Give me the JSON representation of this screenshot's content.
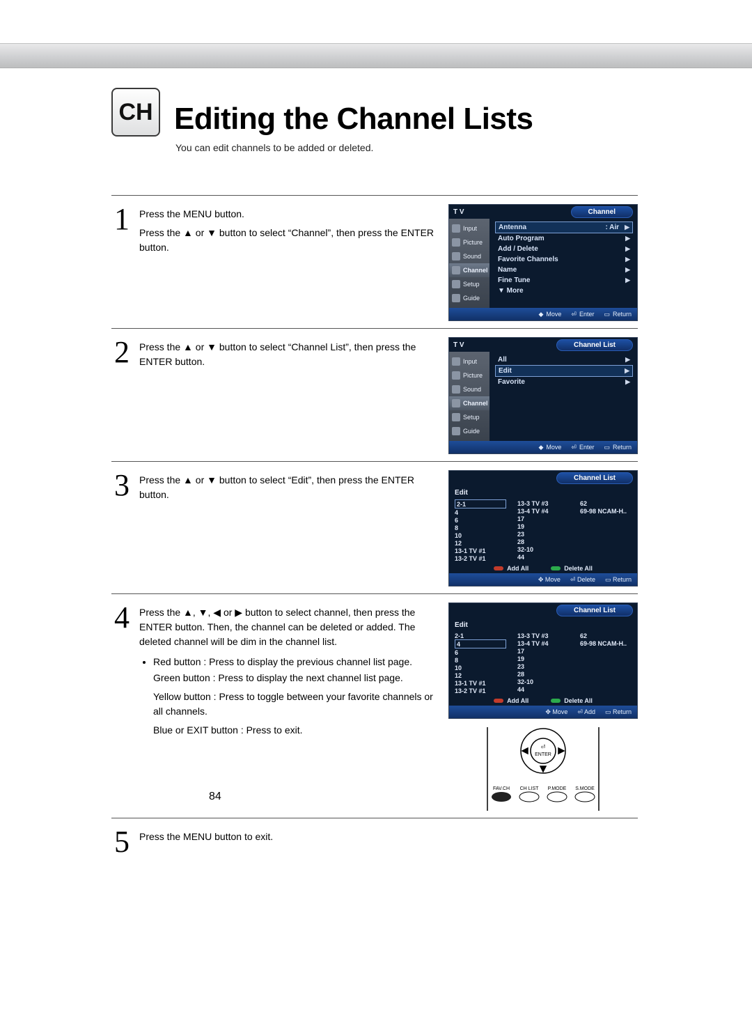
{
  "header": {
    "icon_label": "CH",
    "title": "Editing the Channel Lists",
    "subtitle": "You can edit channels to be added or deleted."
  },
  "page_number": "84",
  "steps": {
    "s1": {
      "num": "1",
      "p1": "Press the MENU button.",
      "p2_pre": "Press the ",
      "p2_mid": " or ",
      "p2_post": " button to select “Channel”, then press the ENTER button."
    },
    "s2": {
      "num": "2",
      "p1_pre": "Press the ",
      "p1_mid": " or ",
      "p1_post": " button to select “Channel List”, then press the ENTER button."
    },
    "s3": {
      "num": "3",
      "p1_pre": "Press the ",
      "p1_mid": " or ",
      "p1_post": " button to select “Edit”, then press the ENTER button."
    },
    "s4": {
      "num": "4",
      "p1": "Press the ▲, ▼, ◀ or ▶ button to select channel, then press the ENTER button. Then, the channel can be deleted or added. The deleted channel will be dim in the channel list.",
      "b1": "Red button : Press to display the previous channel list page.",
      "b2": "Green button : Press to display the next channel list page.",
      "b3": "Yellow button : Press to toggle between your favorite channels or all channels.",
      "b4": "Blue or EXIT button : Press to exit."
    },
    "s5": {
      "num": "5",
      "p1": "Press the MENU button to exit."
    }
  },
  "osd": {
    "tv_label": "T V",
    "sidebar": [
      "Input",
      "Picture",
      "Sound",
      "Channel",
      "Setup",
      "Guide"
    ],
    "menu1": {
      "pill": "Channel",
      "rows": [
        {
          "label": "Antenna",
          "value": ": Air",
          "sel": true
        },
        {
          "label": "Auto Program"
        },
        {
          "label": "Add / Delete"
        },
        {
          "label": "Favorite Channels"
        },
        {
          "label": "Name"
        },
        {
          "label": "Fine Tune"
        },
        {
          "label": "▼ More",
          "no_chev": true
        }
      ]
    },
    "menu2": {
      "pill": "Channel List",
      "rows": [
        {
          "label": "All"
        },
        {
          "label": "Edit",
          "sel": true
        },
        {
          "label": "Favorite"
        }
      ]
    },
    "list1": {
      "pill": "Channel List",
      "edit": "Edit",
      "sel_index": 0,
      "cols": [
        [
          "2-1",
          "4",
          "6",
          "8",
          "10",
          "12",
          "13-1 TV #1",
          "13-2 TV #1"
        ],
        [
          "13-3 TV #3",
          "13-4 TV #4",
          "17",
          "19",
          "23",
          "28",
          "32-10",
          "44"
        ],
        [
          "62",
          "69-98 NCAM-H.."
        ]
      ],
      "actions": {
        "add_all": "Add All",
        "delete_all": "Delete All"
      },
      "footer": {
        "move": "Move",
        "mid": "Delete",
        "return": "Return"
      }
    },
    "list2": {
      "pill": "Channel List",
      "edit": "Edit",
      "sel_index": 1,
      "cols": [
        [
          "2-1",
          "4",
          "6",
          "8",
          "10",
          "12",
          "13-1 TV #1",
          "13-2 TV #1"
        ],
        [
          "13-3 TV #3",
          "13-4 TV #4",
          "17",
          "19",
          "23",
          "28",
          "32-10",
          "44"
        ],
        [
          "62",
          "69-98 NCAM-H.."
        ]
      ],
      "actions": {
        "add_all": "Add All",
        "delete_all": "Delete All"
      },
      "footer": {
        "move": "Move",
        "mid": "Add",
        "return": "Return"
      }
    },
    "footer_menu": {
      "move": "Move",
      "enter": "Enter",
      "return": "Return"
    }
  },
  "remote": {
    "enter": "ENTER",
    "b1": "FAV.CH",
    "b2": "CH LIST",
    "b3": "P.MODE",
    "b4": "S.MODE"
  }
}
